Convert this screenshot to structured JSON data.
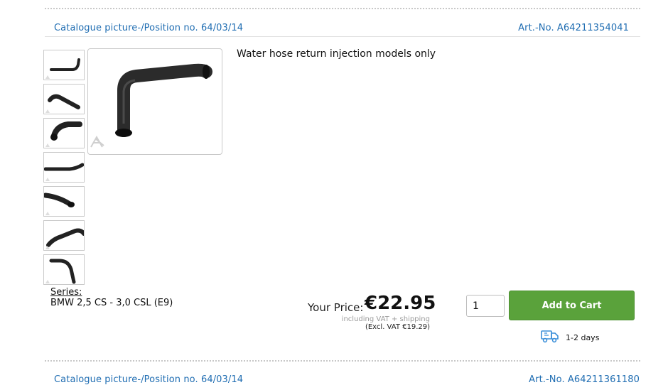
{
  "item1": {
    "catalogue_position": "Catalogue picture-/Position no. 64/03/14",
    "article_number": "Art.-No. A64211354041",
    "description": "Water hose return injection models only",
    "series_label": "Series:",
    "series_value": "BMW 2,5 CS - 3,0 CSL (E9)",
    "price_label": "Your Price:",
    "price": "€22.95",
    "vat_note": "including VAT + shipping",
    "excl_vat": "(Excl. VAT €19.29)",
    "quantity": "1",
    "add_to_cart_label": "Add to Cart",
    "delivery_time": "1-2 days",
    "thumbnails": [
      "hose-view-1",
      "hose-view-2",
      "hose-view-3",
      "hose-view-4",
      "hose-view-5",
      "hose-view-6",
      "hose-view-7"
    ]
  },
  "item2": {
    "catalogue_position": "Catalogue picture-/Position no. 64/03/14",
    "article_number": "Art.-No. A64211361180"
  },
  "colors": {
    "link_blue": "#1f6db2",
    "cart_green": "#5aa23b",
    "delivery_blue": "#3b8fd9"
  },
  "icons": {
    "delivery": "truck-icon",
    "watermark": "brand-logo-watermark"
  }
}
